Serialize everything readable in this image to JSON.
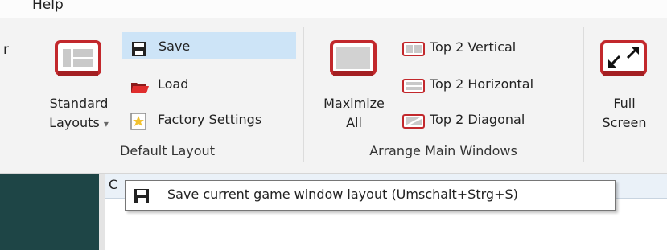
{
  "menu": {
    "help_label": "Help"
  },
  "ribbon": {
    "edge_char": "r",
    "default_layout": {
      "group_label": "Default Layout",
      "standard_layouts": {
        "line1": "Standard",
        "line2": "Layouts",
        "dropdown_arrow": "▾",
        "icon": "layout-window-icon"
      },
      "save_label": "Save",
      "load_label": "Load",
      "factory_settings_label": "Factory Settings"
    },
    "arrange": {
      "group_label": "Arrange Main Windows",
      "maximize": {
        "line1": "Maximize",
        "line2": "All",
        "icon": "maximize-window-icon"
      },
      "top2_vertical_label": "Top 2 Vertical",
      "top2_horizontal_label": "Top 2 Horizontal",
      "top2_diagonal_label": "Top 2 Diagonal"
    },
    "full_screen": {
      "line1": "Full",
      "line2": "Screen",
      "icon": "full-screen-icon"
    }
  },
  "pane": {
    "header_initial": "C"
  },
  "tooltip": {
    "text": "Save current game window layout (Umschalt+Strg+S)"
  },
  "colors": {
    "accent_red": "#c2282c",
    "selected_bg": "#cde4f7",
    "dark_panel": "#1e4546"
  }
}
